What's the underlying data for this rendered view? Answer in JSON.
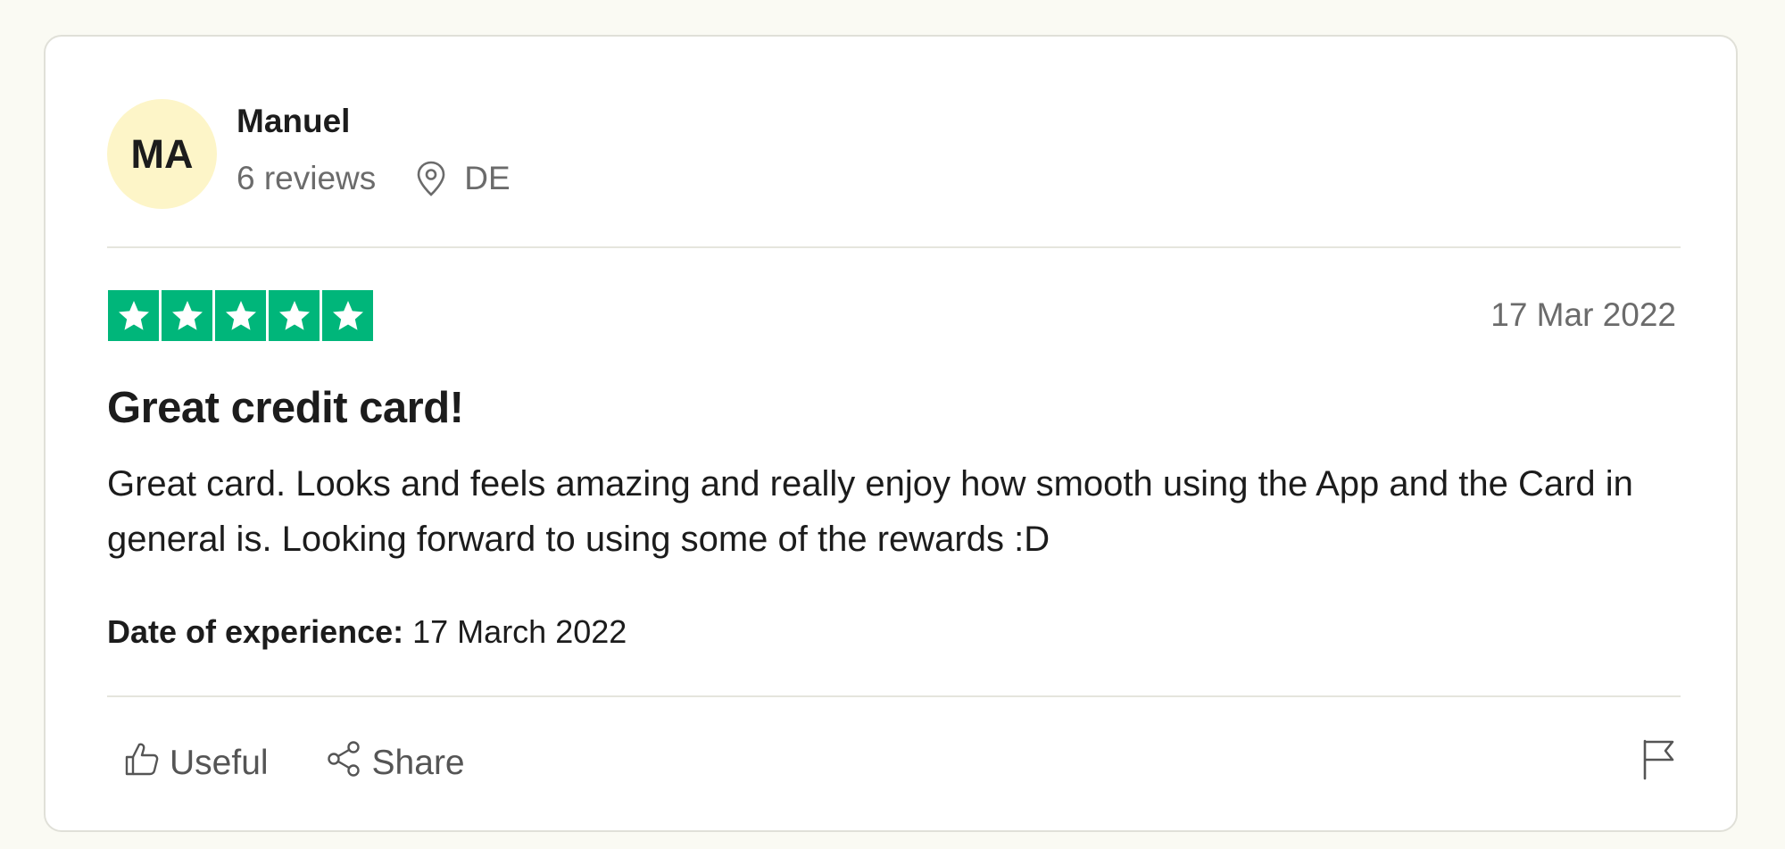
{
  "reviewer": {
    "initials": "MA",
    "name": "Manuel",
    "reviews_count": "6 reviews",
    "country": "DE",
    "location_icon": "location-pin-icon",
    "avatar_color": "#fdf5c8"
  },
  "review": {
    "rating": 5,
    "rating_max": 5,
    "star_color": "#00b67a",
    "date": "17 Mar 2022",
    "title": "Great credit card!",
    "body": "Great card. Looks and feels amazing and really enjoy how smooth using the App and the Card in general is. Looking forward to using some of the rewards :D",
    "experience_label": "Date of experience:",
    "experience_date": "17 March 2022"
  },
  "actions": {
    "useful_label": "Useful",
    "useful_icon": "thumbs-up-icon",
    "share_label": "Share",
    "share_icon": "share-icon",
    "report_icon": "flag-icon"
  }
}
